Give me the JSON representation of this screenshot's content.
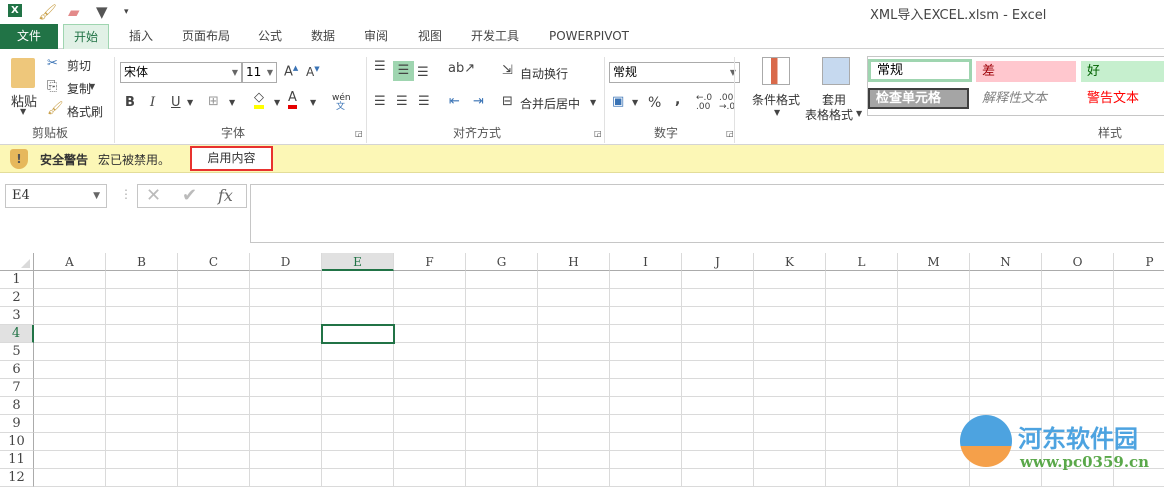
{
  "window": {
    "title": "XML导入EXCEL.xlsm - Excel"
  },
  "tabs": [
    "文件",
    "开始",
    "插入",
    "页面布局",
    "公式",
    "数据",
    "审阅",
    "视图",
    "开发工具",
    "POWERPIVOT"
  ],
  "active_tab": "开始",
  "clipboard": {
    "paste": "粘贴",
    "cut": "剪切",
    "copy": "复制",
    "format_painter": "格式刷",
    "group": "剪贴板"
  },
  "font": {
    "name": "宋体",
    "size": "11",
    "bold": "B",
    "italic": "I",
    "underline": "U",
    "phonetic": "wén",
    "phonetic2": "文",
    "group": "字体"
  },
  "alignment": {
    "wrap": "自动换行",
    "merge": "合并后居中",
    "group": "对齐方式"
  },
  "number": {
    "format": "常规",
    "percent": "%",
    "comma": ",",
    "group": "数字"
  },
  "styles": {
    "conditional": "条件格式",
    "table1": "套用",
    "table2": "表格格式",
    "cells": [
      {
        "label": "常规"
      },
      {
        "label": "差"
      },
      {
        "label": "好"
      },
      {
        "label": "检查单元格"
      },
      {
        "label": "解释性文本"
      },
      {
        "label": "警告文本"
      }
    ],
    "group": "样式"
  },
  "security": {
    "title": "安全警告",
    "message": "宏已被禁用。",
    "button": "启用内容"
  },
  "formula_bar": {
    "name_box": "E4",
    "fx": "fx",
    "value": ""
  },
  "sheet": {
    "columns": [
      "A",
      "B",
      "C",
      "D",
      "E",
      "F",
      "G",
      "H",
      "I",
      "J",
      "K",
      "L",
      "M",
      "N",
      "O",
      "P"
    ],
    "rows": [
      "1",
      "2",
      "3",
      "4",
      "5",
      "6",
      "7",
      "8",
      "9",
      "10",
      "11",
      "12"
    ],
    "active_col": "E",
    "active_row": "4"
  },
  "watermark": {
    "name": "河东软件园",
    "url": "www.pc0359.cn"
  },
  "colors": {
    "accent": "#217346",
    "warning_bg": "#fcf7b6",
    "highlight": "#e8322e"
  }
}
